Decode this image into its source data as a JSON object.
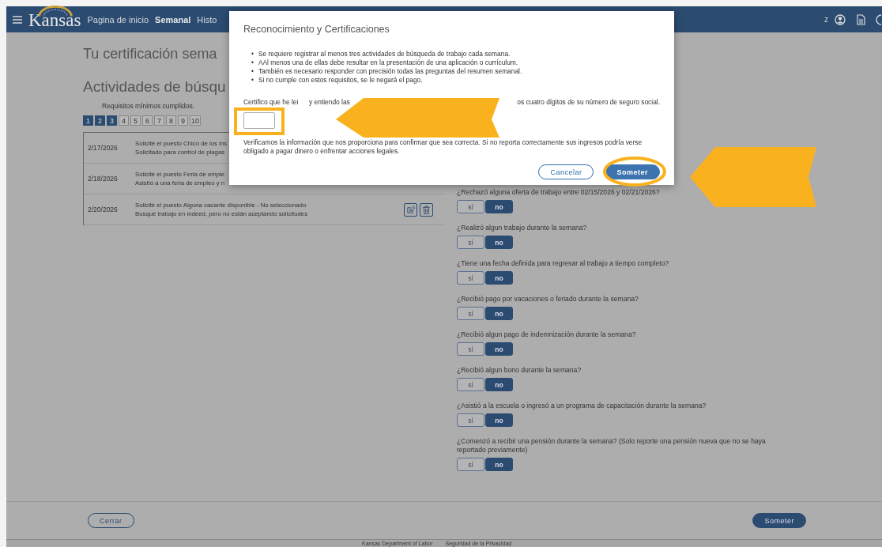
{
  "header": {
    "logo_text": "Kansas",
    "nav": [
      {
        "label": "Pagina de inicio",
        "selected": false
      },
      {
        "label": "Semanal",
        "selected": true
      },
      {
        "label": "Histo",
        "selected": false
      }
    ],
    "user_initial": "z"
  },
  "page": {
    "title": "Tu certificación sema",
    "section_title": "Actividades de búsqu",
    "requirements_label": "Requisitos mínimos cumplidos.",
    "steps": [
      {
        "label": "1",
        "done": true
      },
      {
        "label": "2",
        "done": true
      },
      {
        "label": "3",
        "done": true
      },
      {
        "label": "4",
        "done": false
      },
      {
        "label": "5",
        "done": false
      },
      {
        "label": "6",
        "done": false
      },
      {
        "label": "7",
        "done": false
      },
      {
        "label": "8",
        "done": false
      },
      {
        "label": "9",
        "done": false
      },
      {
        "label": "10",
        "done": false
      }
    ],
    "activities": [
      {
        "date": "2/17/2026",
        "title": "Solicité el puesto Chico de los ins",
        "detail": "Solicitado para control de plagas",
        "actions": false
      },
      {
        "date": "2/18/2026",
        "title": "Solicité el puesto Feria de emple",
        "detail": "Asistió a una feria de empleo y n",
        "actions": false
      },
      {
        "date": "2/20/2026",
        "title": "Solicité el puesto Alguna vacante disponible - No seleccionado",
        "detail": "Busqué trabajo en indeed, pero no están aceptando solicitudes",
        "actions": true
      }
    ]
  },
  "questions": [
    {
      "text": "¿Rechazó alguna oferta de trabajo entre 02/15/2026 y 02/21/2026?",
      "options": [
        {
          "label": "sí",
          "selected": false
        },
        {
          "label": "no",
          "selected": true
        }
      ]
    },
    {
      "text": "¿Realizó algun trabajo durante la semana?",
      "options": [
        {
          "label": "sí",
          "selected": false
        },
        {
          "label": "no",
          "selected": true
        }
      ]
    },
    {
      "text": "¿Tiene una fecha definida para regresar al trabajo a tiempo completo?",
      "options": [
        {
          "label": "sí",
          "selected": false
        },
        {
          "label": "no",
          "selected": true
        }
      ]
    },
    {
      "text": "¿Recibió pago por vacaciones o feriado durante la semana?",
      "options": [
        {
          "label": "sí",
          "selected": false
        },
        {
          "label": "no",
          "selected": true
        }
      ]
    },
    {
      "text": "¿Recibió algun pago de indemnización durante la semana?",
      "options": [
        {
          "label": "sí",
          "selected": false
        },
        {
          "label": "no",
          "selected": true
        }
      ]
    },
    {
      "text": "¿Recibió algun bono durante la semana?",
      "options": [
        {
          "label": "sí",
          "selected": false
        },
        {
          "label": "no",
          "selected": true
        }
      ]
    },
    {
      "text": "¿Asistió a la escuela o ingresó a un programa de capacitación durante la semana?",
      "options": [
        {
          "label": "sí",
          "selected": false
        },
        {
          "label": "no",
          "selected": true
        }
      ]
    },
    {
      "text": "¿Comenzó a recibir una pensión durante la semana? (Solo reporte una pensión nueva que no se haya reportado previamente)",
      "options": [
        {
          "label": "sí",
          "selected": false
        },
        {
          "label": "no",
          "selected": true
        }
      ]
    }
  ],
  "footer": {
    "close_button": "Cerrar",
    "submit_button": "Someter",
    "links": [
      "Kansas Department of Labor",
      "Seguridad de la Privacidad"
    ]
  },
  "modal": {
    "title": "Reconocimiento y Certificaciones",
    "bullets": [
      {
        "marker": "•",
        "text": "Se requiere registrar al menos tres actividades de búsqueda de trabajo cada semana."
      },
      {
        "marker": "•",
        "text": "AAl menos una de ellas debe resultar en la presentación de una aplicación o currículum."
      },
      {
        "marker": "•",
        "text": "También es necesario responder con precisión todas las preguntas del resumen semanal."
      },
      {
        "marker": "•",
        "text": "Si no cumple con estos requisitos, se le negará el pago."
      }
    ],
    "certify_fragments": [
      "Certifico que he lei",
      "y entiendo las",
      "os cuatro dígitos de su número de seguro social."
    ],
    "verify_text": "Verificamos la información que nos proporciona para confirmar que sea correcta. Si no reporta correctamente sus ingresos podría verse obligado a pagar dinero o enfrentar acciones legales.",
    "cancel_button": "Cancelar",
    "submit_button": "Someter"
  }
}
